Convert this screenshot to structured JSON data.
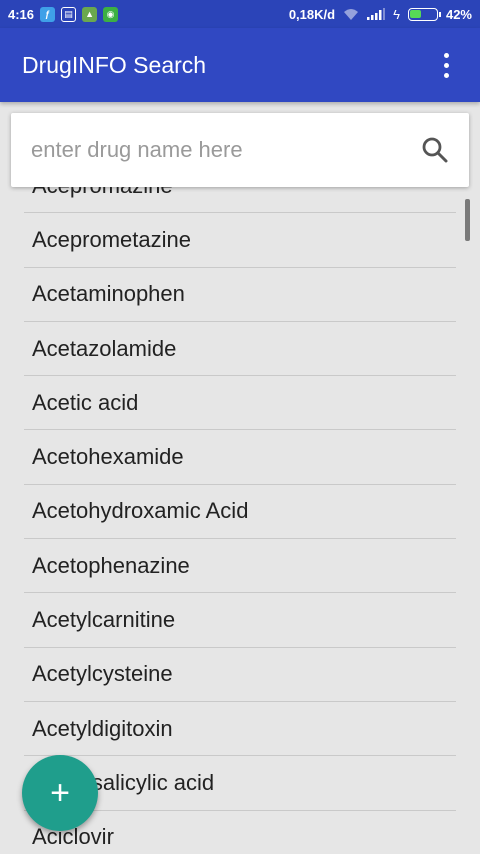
{
  "status_bar": {
    "time": "4:16",
    "data_speed": "0,18K/d",
    "battery_level": 0.42,
    "battery_percent": "42%",
    "icons": [
      "app-icon-blue",
      "message-icon",
      "image-icon",
      "android-icon",
      "wifi-icon",
      "signal-icon",
      "charging-icon",
      "battery-icon"
    ]
  },
  "app_bar": {
    "title": "DrugINFO Search",
    "overflow_icon": "more-vert-icon"
  },
  "search": {
    "placeholder": "enter drug name here",
    "value": "",
    "icon": "search-icon"
  },
  "drug_list": [
    "Acepromazine",
    "Aceprometazine",
    "Acetaminophen",
    "Acetazolamide",
    "Acetic acid",
    "Acetohexamide",
    "Acetohydroxamic Acid",
    "Acetophenazine",
    "Acetylcarnitine",
    "Acetylcysteine",
    "Acetyldigitoxin",
    "Acetylsalicylic acid",
    "Aciclovir"
  ],
  "fab": {
    "label": "+",
    "icon": "add-icon"
  },
  "colors": {
    "status_bar": "#2b44b8",
    "app_bar": "#3048c2",
    "background": "#e6e6e6",
    "fab": "#1f9e8c"
  }
}
